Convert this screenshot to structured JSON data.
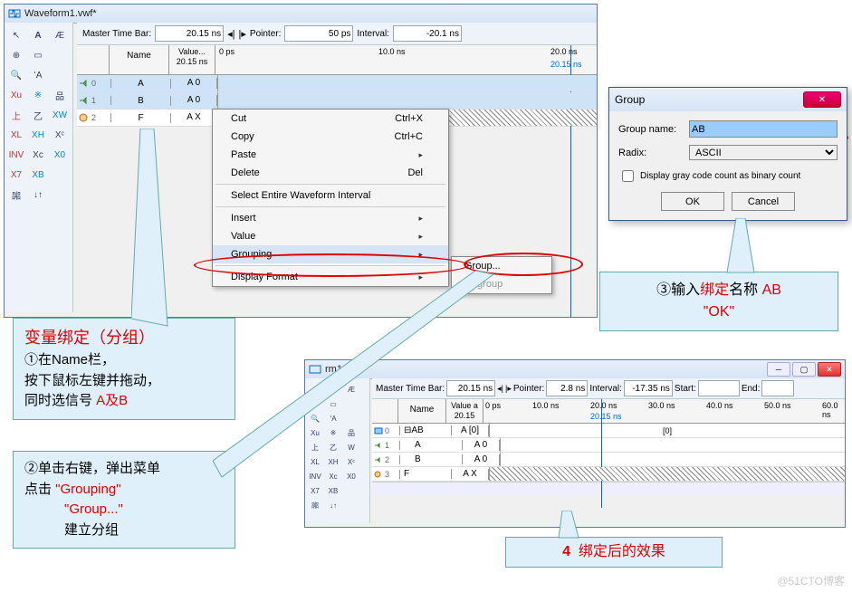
{
  "main_window": {
    "title": "Waveform1.vwf*",
    "timebar": {
      "master_label": "Master Time Bar:",
      "master_value": "20.15 ns",
      "pointer_label": "Pointer:",
      "pointer_value": "50 ps",
      "interval_label": "Interval:",
      "interval_value": "-20.1 ns"
    },
    "columns": {
      "name": "Name",
      "value_line1": "Value...",
      "value_line2": "20.15 ns"
    },
    "ruler": {
      "t0": "0 ps",
      "t1": "10.0 ns",
      "t2": "20.0 ns",
      "marker": "20.15 ns"
    },
    "signals": [
      {
        "idx": "0",
        "name": "A",
        "value": "A 0",
        "selected": true
      },
      {
        "idx": "1",
        "name": "B",
        "value": "A 0",
        "selected": true
      },
      {
        "idx": "2",
        "name": "F",
        "value": "A X",
        "selected": false
      }
    ]
  },
  "context_menu": {
    "items": [
      {
        "label": "Cut",
        "shortcut": "Ctrl+X"
      },
      {
        "label": "Copy",
        "shortcut": "Ctrl+C"
      },
      {
        "label": "Paste",
        "shortcut": "",
        "arrow": true
      },
      {
        "label": "Delete",
        "shortcut": "Del"
      },
      {
        "sep": true
      },
      {
        "label": "Select Entire Waveform Interval"
      },
      {
        "sep": true
      },
      {
        "label": "Insert",
        "arrow": true
      },
      {
        "label": "Value",
        "arrow": true
      },
      {
        "label": "Grouping",
        "arrow": true,
        "hi": true
      },
      {
        "sep": true
      },
      {
        "label": "Display Format",
        "arrow": true
      }
    ],
    "submenu": [
      {
        "label": "Group..."
      },
      {
        "label": "Ungroup",
        "disabled": true
      }
    ]
  },
  "group_dialog": {
    "title": "Group",
    "name_label": "Group name:",
    "name_value": "AB",
    "radix_label": "Radix:",
    "radix_value": "ASCII",
    "checkbox_label": "Display gray code count as binary count",
    "ok": "OK",
    "cancel": "Cancel"
  },
  "result_window": {
    "title": "rm1.vwf*",
    "timebar": {
      "master_label": "Master Time Bar:",
      "master_value": "20.15 ns",
      "pointer_label": "Pointer:",
      "pointer_value": "2.8 ns",
      "interval_label": "Interval:",
      "interval_value": "-17.35 ns",
      "start_label": "Start:",
      "end_label": "End:"
    },
    "columns": {
      "name": "Name",
      "value_line1": "Value a",
      "value_line2": "20.15"
    },
    "ruler": {
      "t0": "0 ps",
      "t1": "10.0 ns",
      "t2": "20.0 ns",
      "marker": "20.15 ns",
      "t3": "30.0 ns",
      "t4": "40.0 ns",
      "t5": "50.0 ns",
      "t6": "60.0 ns"
    },
    "signals": [
      {
        "idx": "0",
        "name": "AB",
        "value": "A [0]",
        "expandable": true,
        "bus_value": "[0]"
      },
      {
        "idx": "1",
        "name": "A",
        "value": "A 0",
        "child": true
      },
      {
        "idx": "2",
        "name": "B",
        "value": "A 0",
        "child": true
      },
      {
        "idx": "3",
        "name": "F",
        "value": "A X"
      }
    ]
  },
  "annotations": {
    "a1_title": "变量绑定（分组）",
    "a1_l1a": "①在Name栏，",
    "a1_l2": "按下鼠标左键并拖动，",
    "a1_l3a": "同时选信号 ",
    "a1_l3b": "A及B",
    "a2_l1": "②单击右键，弹出菜单",
    "a2_l2a": "点击 ",
    "a2_l2b": "\"Grouping\"",
    "a2_l3": "\"Group...\"",
    "a2_l4": "建立分组",
    "a3_l1a": "③输入",
    "a3_l1b": "绑定",
    "a3_l1c": "名称 ",
    "a3_l1d": "AB",
    "a3_l2": "\"OK\"",
    "a4_num": "4",
    "a4_text": "绑定后的效果"
  },
  "watermark": "@51CTO博客"
}
